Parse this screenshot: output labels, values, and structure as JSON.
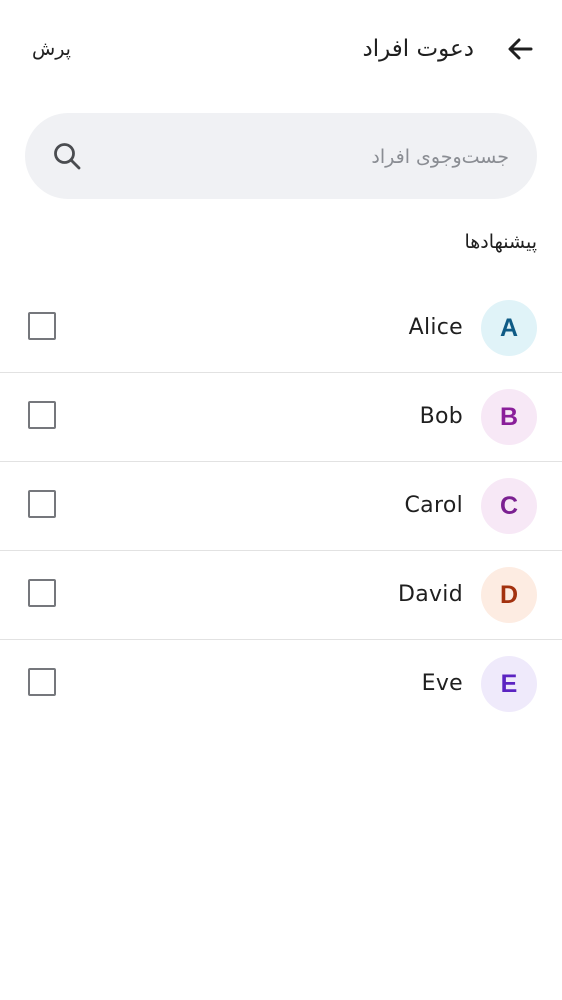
{
  "header": {
    "title": "دعوت افراد",
    "skip_label": "پرش",
    "back_icon": "arrow-back-icon"
  },
  "search": {
    "placeholder": "جست‌وجوی افراد",
    "value": "",
    "icon": "search-icon"
  },
  "suggestions": {
    "label": "پیشنهادها",
    "people": [
      {
        "name": "Alice",
        "initial": "A",
        "bg": "#e0f3f8",
        "fg": "#0f5b86",
        "checked": false
      },
      {
        "name": "Bob",
        "initial": "B",
        "bg": "#f7e8f6",
        "fg": "#8a1e9a",
        "checked": false
      },
      {
        "name": "Carol",
        "initial": "C",
        "bg": "#f7e8f6",
        "fg": "#7b2091",
        "checked": false
      },
      {
        "name": "David",
        "initial": "D",
        "bg": "#fdece2",
        "fg": "#a3320f",
        "checked": false
      },
      {
        "name": "Eve",
        "initial": "E",
        "bg": "#efeafb",
        "fg": "#5b24c2",
        "checked": false
      }
    ]
  },
  "colors": {
    "background": "#ffffff",
    "search_bg": "#f0f1f4",
    "divider": "#e2e2e2",
    "checkbox_border": "#75777c",
    "text": "#1f1f1f",
    "placeholder": "#8a8d93"
  }
}
